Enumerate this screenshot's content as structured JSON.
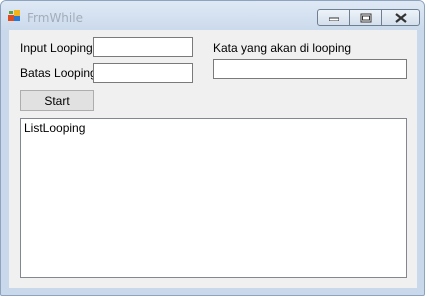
{
  "window": {
    "title": "FrmWhile",
    "app_icon": "winforms-app-icon",
    "controls": [
      "minimize-icon",
      "maximize-icon",
      "close-icon"
    ]
  },
  "form": {
    "input_looping_label": "Input Looping",
    "input_looping_value": "",
    "batas_looping_label": "Batas Looping",
    "batas_looping_value": "",
    "kata_label": "Kata yang akan di looping",
    "kata_value": "",
    "start_label": "Start",
    "list_items": [
      "ListLooping"
    ]
  }
}
